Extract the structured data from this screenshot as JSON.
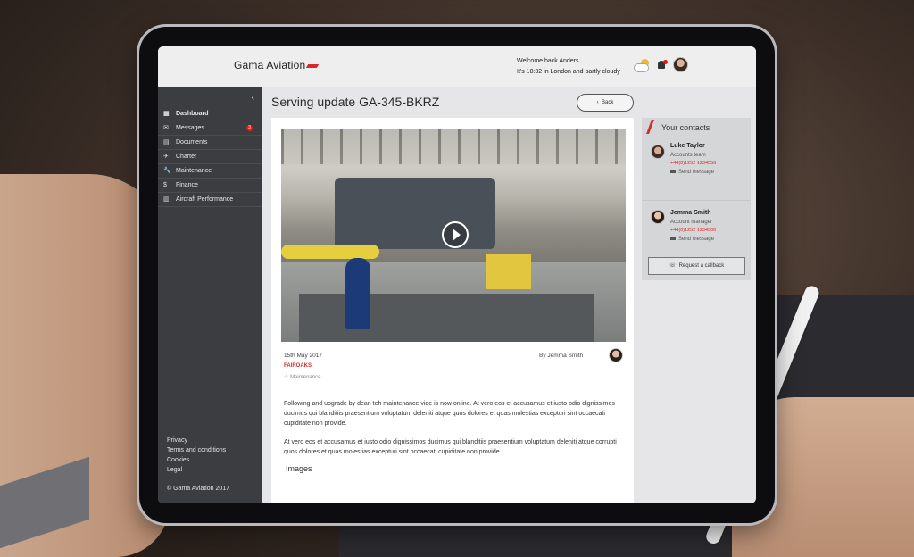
{
  "app": {
    "logo_text": "Gama Aviation"
  },
  "header": {
    "welcome": "Welcome back Anders",
    "status": "It's 18:32 in London and partly cloudy",
    "icons": [
      "weather-partly-cloudy-icon",
      "bell-icon",
      "avatar"
    ]
  },
  "sidebar": {
    "collapse_icon": "‹",
    "items": [
      {
        "label": "Dashboard",
        "icon": "▦",
        "active": true
      },
      {
        "label": "Messages",
        "icon": "✉",
        "badge": "3"
      },
      {
        "label": "Documents",
        "icon": "▤"
      },
      {
        "label": "Charter",
        "icon": "✈"
      },
      {
        "label": "Maintenance",
        "icon": "🔧"
      },
      {
        "label": "Finance",
        "icon": "$"
      },
      {
        "label": "Aircraft Performance",
        "icon": "▥"
      }
    ],
    "footer_links": [
      "Privacy",
      "Terms and conditions",
      "Cookies",
      "Legal"
    ],
    "copyright": "© Gama Aviation 2017"
  },
  "main": {
    "title": "Serving update GA-345-BKRZ",
    "back_label": "Back",
    "back_icon": "‹",
    "article": {
      "date": "15th May 2017",
      "location": "FAIROAKS",
      "tag": "Maintenance",
      "tag_icon": "☆",
      "author": "By Jemma Smith",
      "para1": "Following and upgrade by dean teh maintenance vide is now online. At vero eos et accusamus et iusto odio dignissimos ducimus qui blanditiis praesentium voluptatum deleniti atque   quos dolores et quas molestias excepturi sint occaecati cupiditate non provide.",
      "para2": "At vero eos et accusamus et iusto odio dignissimos ducimus qui blanditiis praesentium voluptatum deleniti atque corrupti quos dolores et quas molestias excepturi sint occaecati cupiditate non provide.",
      "images_heading": "Images"
    }
  },
  "contacts": {
    "title": "Your contacts",
    "list": [
      {
        "name": "Luke Taylor",
        "role": "Accounts team",
        "phone": "+44(0)1252 1234556",
        "action": "Send message"
      },
      {
        "name": "Jemma Smith",
        "role": "Account manager",
        "phone": "+44(0)1252 1234500",
        "action": "Send message"
      }
    ],
    "callback_label": "Request a callback",
    "callback_icon": "☏"
  },
  "colors": {
    "accent": "#d62a2a",
    "sidebar": "#3b3d41"
  }
}
